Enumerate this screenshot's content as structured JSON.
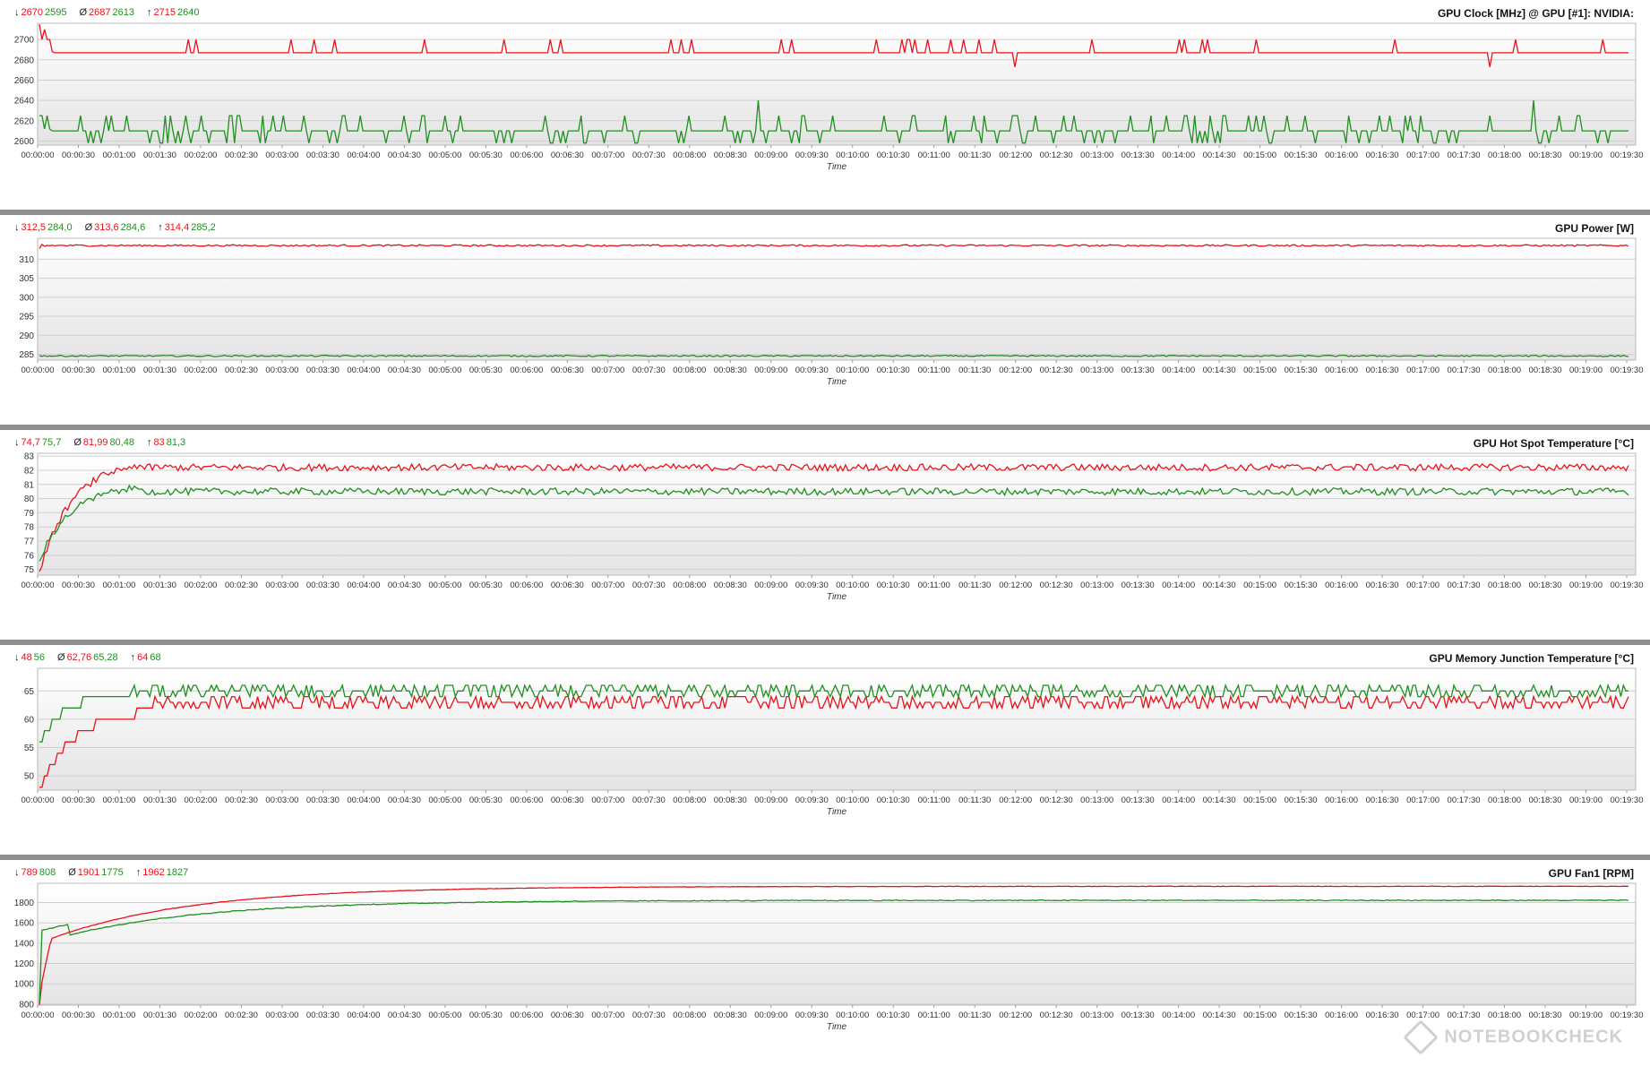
{
  "colors": {
    "red": "#e8121b",
    "green": "#1f8f1f",
    "grid": "#cfcfcf",
    "plot_top": "#ffffff",
    "plot_bottom": "#e4e4e4"
  },
  "chart_data": [
    {
      "type": "line",
      "title": "GPU Clock [MHz] @ GPU [#1]: NVIDIA:",
      "xlabel": "Time",
      "stats": {
        "min_icon": "↓",
        "min": "2670",
        "min2": "2595",
        "avg_icon": "Ø",
        "avg": "2687",
        "avg2": "2613",
        "max_icon": "↑",
        "max": "2715",
        "max2": "2640"
      },
      "yticks": [
        2600,
        2620,
        2640,
        2660,
        2680,
        2700
      ],
      "ylim": [
        2596,
        2716
      ],
      "series": [
        {
          "color": "red",
          "base": 2687,
          "noise": 0,
          "spike_hi": 2700,
          "spike_lo": 2687,
          "spike_rate": 0.11,
          "dip": 2673,
          "start": [
            2715,
            2700,
            2710,
            2700,
            2700,
            2688
          ]
        },
        {
          "color": "green",
          "base": 2610,
          "noise": 0,
          "spike_hi": 2625,
          "spike_lo": 2598,
          "spike_rate": 0.22,
          "dip": 2640,
          "start": [
            2625,
            2625,
            2612,
            2625,
            2612
          ]
        }
      ]
    },
    {
      "type": "line",
      "title": "GPU Power [W]",
      "xlabel": "Time",
      "stats": {
        "min_icon": "↓",
        "min": "312,5",
        "min2": "284,0",
        "avg_icon": "Ø",
        "avg": "313,6",
        "avg2": "284,6",
        "max_icon": "↑",
        "max": "314,4",
        "max2": "285,2"
      },
      "yticks": [
        285,
        290,
        295,
        300,
        305,
        310
      ],
      "ylim": [
        283.5,
        315.5
      ],
      "series": [
        {
          "color": "red",
          "base": 313.6,
          "noise": 0.22,
          "start": [
            312.8,
            313.9,
            313.4
          ]
        },
        {
          "color": "green",
          "base": 284.6,
          "noise": 0.18,
          "start": [
            284.7,
            284.5
          ]
        }
      ]
    },
    {
      "type": "line",
      "title": "GPU Hot Spot Temperature [°C]",
      "xlabel": "Time",
      "stats": {
        "min_icon": "↓",
        "min": "74,7",
        "min2": "75,7",
        "avg_icon": "Ø",
        "avg": "81,99",
        "avg2": "80,48",
        "max_icon": "↑",
        "max": "83",
        "max2": "81,3"
      },
      "yticks": [
        75,
        76,
        77,
        78,
        79,
        80,
        81,
        82,
        83
      ],
      "ylim": [
        74.6,
        83.2
      ],
      "series": [
        {
          "color": "red",
          "base": 82.2,
          "noise": 0.25,
          "warm_from": 74.8,
          "warm_to": 82.7,
          "warm_pts": 40
        },
        {
          "color": "green",
          "base": 80.5,
          "noise": 0.25,
          "warm_from": 75.7,
          "warm_to": 81.0,
          "warm_pts": 40
        }
      ]
    },
    {
      "type": "line",
      "title": "GPU Memory Junction Temperature [°C]",
      "xlabel": "Time",
      "stats": {
        "min_icon": "↓",
        "min": "48",
        "min2": "56",
        "avg_icon": "Ø",
        "avg": "62,76",
        "avg2": "65,28",
        "max_icon": "↑",
        "max": "64",
        "max2": "68"
      },
      "yticks": [
        50,
        55,
        60,
        65
      ],
      "ylim": [
        47.5,
        69
      ],
      "series": [
        {
          "color": "red",
          "base": 63,
          "noise": 0,
          "steps": [
            62,
            64
          ],
          "warm_from": 48,
          "warm_to": 62,
          "warm_pts": 45
        },
        {
          "color": "green",
          "base": 65,
          "noise": 0,
          "steps": [
            64,
            66
          ],
          "warm_from": 56,
          "warm_to": 65,
          "warm_pts": 35
        }
      ]
    },
    {
      "type": "line",
      "title": "GPU Fan1 [RPM]",
      "xlabel": "Time",
      "stats": {
        "min_icon": "↓",
        "min": "789",
        "min2": "808",
        "avg_icon": "Ø",
        "avg": "1901",
        "avg2": "1775",
        "max_icon": "↑",
        "max": "1962",
        "max2": "1827"
      },
      "yticks": [
        800,
        1000,
        1200,
        1400,
        1600,
        1800
      ],
      "ylim": [
        790,
        1990
      ],
      "series": [
        {
          "color": "red",
          "base": 1960,
          "noise": 2,
          "fan_from": 790,
          "fan_to": 1960
        },
        {
          "color": "green",
          "base": 1820,
          "noise": 4,
          "fan_from": 808,
          "fan_to": 1822,
          "fan_bump": 1520
        }
      ]
    }
  ],
  "xticks": [
    "00:00:00",
    "00:00:30",
    "00:01:00",
    "00:01:30",
    "00:02:00",
    "00:02:30",
    "00:03:00",
    "00:03:30",
    "00:04:00",
    "00:04:30",
    "00:05:00",
    "00:05:30",
    "00:06:00",
    "00:06:30",
    "00:07:00",
    "00:07:30",
    "00:08:00",
    "00:08:30",
    "00:09:00",
    "00:09:30",
    "00:10:00",
    "00:10:30",
    "00:11:00",
    "00:11:30",
    "00:12:00",
    "00:12:30",
    "00:13:00",
    "00:13:30",
    "00:14:00",
    "00:14:30",
    "00:15:00",
    "00:15:30",
    "00:16:00",
    "00:16:30",
    "00:17:00",
    "00:17:30",
    "00:18:00",
    "00:18:30",
    "00:19:00",
    "00:19:30"
  ],
  "watermark": "NOTEBOOKCHECK"
}
